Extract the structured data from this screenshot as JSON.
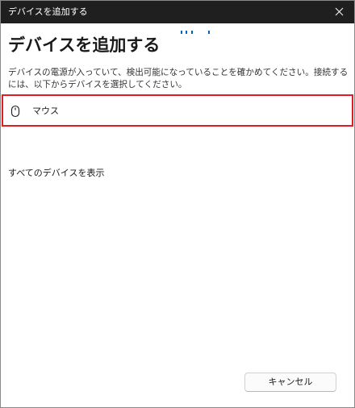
{
  "window": {
    "title": "デバイスを追加する"
  },
  "icons": {
    "close": "close-icon",
    "mouse": "mouse-icon",
    "progress": "searching-progress-dots"
  },
  "colors": {
    "titlebar": "#1f1f1f",
    "accent": "#0067c0",
    "highlight_border": "#e31b23"
  },
  "main": {
    "heading": "デバイスを追加する",
    "description": "デバイスの電源が入っていて、検出可能になっていることを確かめてください。接続するには、以下からデバイスを選択してください。",
    "devices": [
      {
        "label": "マウス",
        "icon": "mouse-icon"
      }
    ],
    "show_all_label": "すべてのデバイスを表示"
  },
  "footer": {
    "cancel_label": "キャンセル"
  }
}
